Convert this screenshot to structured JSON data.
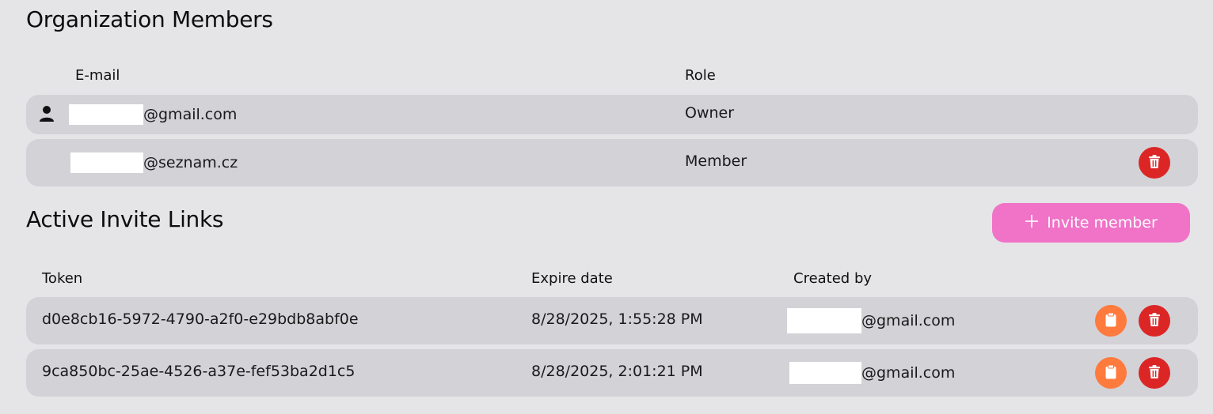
{
  "members_section": {
    "title": "Organization Members",
    "columns": {
      "email": "E-mail",
      "role": "Role"
    },
    "rows": [
      {
        "email_suffix": "@gmail.com",
        "role": "Owner"
      },
      {
        "email_suffix": "@seznam.cz",
        "role": "Member"
      }
    ]
  },
  "invites_section": {
    "title": "Active Invite Links",
    "invite_button_label": "Invite member",
    "columns": {
      "token": "Token",
      "expire": "Expire date",
      "created_by": "Created by"
    },
    "rows": [
      {
        "token": "d0e8cb16-5972-4790-a2f0-e29bdb8abf0e",
        "expire": "8/28/2025, 1:55:28 PM",
        "created_by_suffix": "@gmail.com"
      },
      {
        "token": "9ca850bc-25ae-4526-a37e-fef53ba2d1c5",
        "expire": "8/28/2025, 2:01:21 PM",
        "created_by_suffix": "@gmail.com"
      }
    ]
  },
  "icons": {
    "owner": "person-icon",
    "delete": "trash-icon",
    "copy": "clipboard-icon",
    "add": "plus-icon"
  },
  "colors": {
    "delete_button": "#dc2626",
    "copy_button": "#ff7a3d",
    "invite_button": "#f073c8",
    "row_background": "#d3d2d7",
    "page_background": "#e5e5e8"
  }
}
